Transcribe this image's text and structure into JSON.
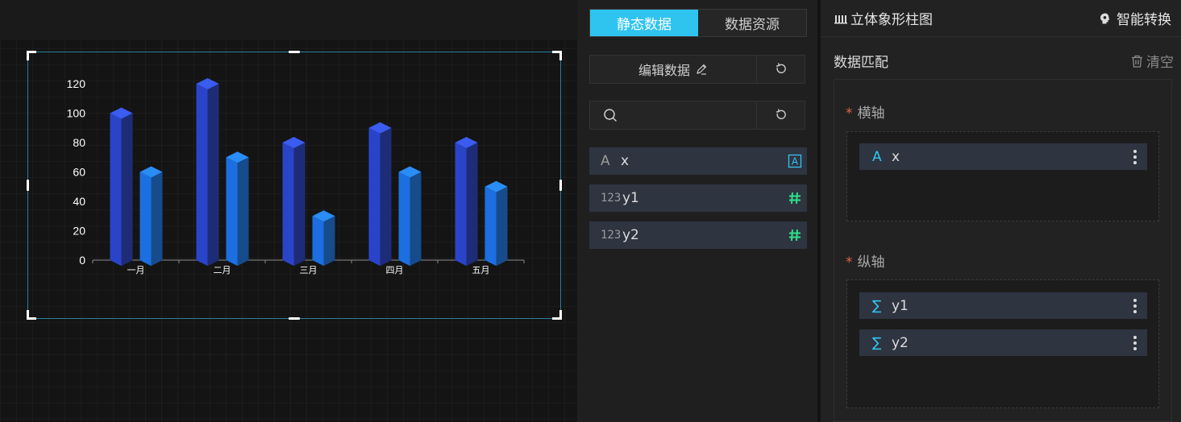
{
  "data_panel": {
    "tabs": [
      {
        "label": "静态数据",
        "active": true
      },
      {
        "label": "数据资源",
        "active": false
      }
    ],
    "edit_button_label": "编辑数据",
    "search": {
      "placeholder": "",
      "value": ""
    },
    "fields": [
      {
        "type_icon": "text-type-icon",
        "type_label": "A",
        "name": "x",
        "badge": "text-badge-icon"
      },
      {
        "type_icon": "number-type-icon",
        "type_label": "123",
        "name": "y1",
        "badge": "hash-icon"
      },
      {
        "type_icon": "number-type-icon",
        "type_label": "123",
        "name": "y2",
        "badge": "hash-icon"
      }
    ]
  },
  "config_panel": {
    "chart_type_label": "立体象形柱图",
    "smart_convert_label": "智能转换",
    "section_title": "数据匹配",
    "clear_label": "清空",
    "x_axis": {
      "label": "横轴",
      "fields": [
        {
          "type_label": "A",
          "name": "x"
        }
      ]
    },
    "y_axis": {
      "label": "纵轴",
      "fields": [
        {
          "type_label": "∑",
          "name": "y1"
        },
        {
          "type_label": "∑",
          "name": "y2"
        }
      ]
    }
  },
  "colors": {
    "accent": "#2fc4f0",
    "series_1": "#2a44c9",
    "series_2": "#1b6fe0",
    "hash_badge": "#2fe08a",
    "required": "#e0604f"
  },
  "chart_data": {
    "type": "bar",
    "categories": [
      "一月",
      "二月",
      "三月",
      "四月",
      "五月"
    ],
    "series": [
      {
        "values": [
          100,
          120,
          80,
          90,
          80
        ]
      },
      {
        "values": [
          60,
          70,
          30,
          60,
          50
        ]
      }
    ],
    "yticks": [
      "0",
      "20",
      "40",
      "60",
      "80",
      "100",
      "120"
    ],
    "ylim": [
      0,
      120
    ],
    "legend": "none",
    "grid": false
  }
}
